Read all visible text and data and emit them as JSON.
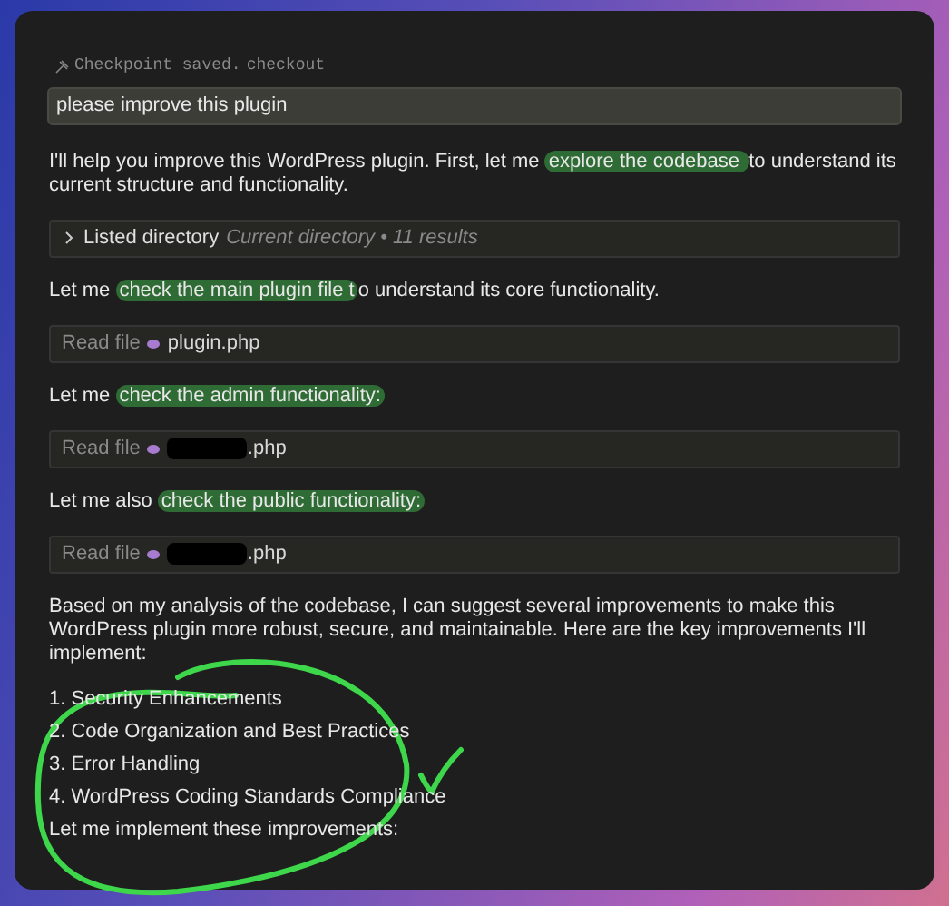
{
  "checkpoint": {
    "label": "Checkpoint saved.",
    "action": "checkout"
  },
  "prompt": {
    "text": "please improve this plugin"
  },
  "messages": [
    {
      "kind": "text",
      "parts": [
        {
          "text": "I'll help you improve this WordPress plugin. First, let me ",
          "highlighted": false
        },
        {
          "text": "explore the codebase ",
          "highlighted": true
        },
        {
          "text": "to understand its current structure and functionality.",
          "highlighted": false
        }
      ]
    },
    {
      "kind": "directory",
      "label": "Listed directory",
      "detail": "Current directory • 11 results",
      "expanded": false
    },
    {
      "kind": "text",
      "parts": [
        {
          "text": "Let me ",
          "highlighted": false
        },
        {
          "text": "check the main plugin file t",
          "highlighted": true
        },
        {
          "text": "o understand its core functionality.",
          "highlighted": false
        }
      ]
    },
    {
      "kind": "file",
      "label": "Read file",
      "file": "plugin.php",
      "redacted": false
    },
    {
      "kind": "text",
      "parts": [
        {
          "text": "Let me ",
          "highlighted": false
        },
        {
          "text": "check the admin functionality:",
          "highlighted": true
        }
      ]
    },
    {
      "kind": "file",
      "label": "Read file",
      "file": ".php",
      "redacted": true
    },
    {
      "kind": "text",
      "parts": [
        {
          "text": "Let me also ",
          "highlighted": false
        },
        {
          "text": "check the public functionality:",
          "highlighted": true
        }
      ]
    },
    {
      "kind": "file",
      "label": "Read file",
      "file": ".php",
      "redacted": true
    },
    {
      "kind": "text",
      "parts": [
        {
          "text": "Based on my analysis of the codebase, I can suggest several improvements to make this WordPress plugin more robust, secure, and maintainable. Here are the key improvements I'll implement:",
          "highlighted": false
        }
      ]
    },
    {
      "kind": "item",
      "text": "1. Security Enhancements"
    },
    {
      "kind": "item",
      "text": "2. Code Organization and Best Practices"
    },
    {
      "kind": "item",
      "text": "3. Error Handling"
    },
    {
      "kind": "item",
      "text": "4. WordPress Coding Standards Compliance"
    },
    {
      "kind": "item",
      "text": "Let me implement these improvements:"
    }
  ]
}
